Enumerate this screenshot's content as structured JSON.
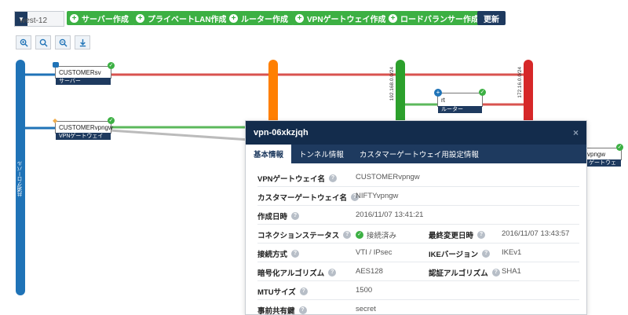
{
  "toolbar": {
    "region": "west-12",
    "buttons": [
      "サーバー作成",
      "プライベートLAN作成",
      "ルーター作成",
      "VPNゲートウェイ作成",
      "ロードバランサー作成"
    ],
    "refresh": "更新"
  },
  "diagram": {
    "global_label": "共通グローバル",
    "network1_label": "192.168.0.0/24",
    "network2_label": "172.16.0.0/24",
    "nodes": [
      {
        "name": "CUSTOMERsv",
        "type": "サーバー"
      },
      {
        "name": "CUSTOMERvpngw",
        "type": "VPNゲートウェイ"
      },
      {
        "name": "rt",
        "type": "ルーター"
      },
      {
        "name": "vpngw",
        "type": "ゲートウェ"
      }
    ],
    "colors": {
      "global": "#1f73b7",
      "orange": "#ff7f00",
      "green": "#2ca02c",
      "red": "#d62728"
    }
  },
  "modal": {
    "title": "vpn-06xkzjqh",
    "close": "×",
    "tabs": [
      "基本情報",
      "トンネル情報",
      "カスタマーゲートウェイ用設定情報"
    ],
    "fields": {
      "vpn_gw_name": {
        "label": "VPNゲートウェイ名",
        "value": "CUSTOMERvpngw"
      },
      "customer_gw_name": {
        "label": "カスタマーゲートウェイ名",
        "value": "NIFTYvpngw"
      },
      "created": {
        "label": "作成日時",
        "value": "2016/11/07 13:41:21"
      },
      "conn_status": {
        "label": "コネクションステータス",
        "value": "接続済み"
      },
      "last_modified": {
        "label": "最終変更日時",
        "value": "2016/11/07 13:43:57"
      },
      "conn_type": {
        "label": "接続方式",
        "value": "VTI / IPsec"
      },
      "ike_version": {
        "label": "IKEバージョン",
        "value": "IKEv1"
      },
      "encryption": {
        "label": "暗号化アルゴリズム",
        "value": "AES128"
      },
      "auth": {
        "label": "認証アルゴリズム",
        "value": "SHA1"
      },
      "mtu": {
        "label": "MTUサイズ",
        "value": "1500"
      },
      "psk": {
        "label": "事前共有鍵",
        "value": "secret"
      }
    }
  }
}
